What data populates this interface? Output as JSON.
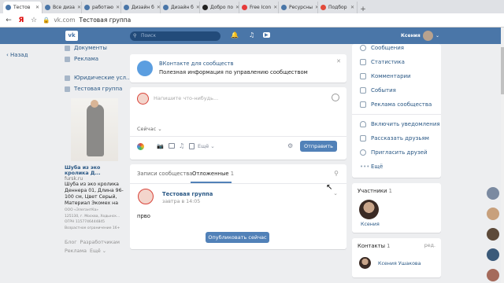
{
  "browser": {
    "tabs": [
      {
        "label": "Тестов",
        "color": "#4a76a8",
        "active": true
      },
      {
        "label": "Все диза",
        "color": "#4a76a8"
      },
      {
        "label": "работаю",
        "color": "#4a76a8"
      },
      {
        "label": "Дизайн б",
        "color": "#4a76a8"
      },
      {
        "label": "Дизайн б",
        "color": "#4a76a8"
      },
      {
        "label": "Добро по",
        "color": "#222222"
      },
      {
        "label": "Free Icon",
        "color": "#e63a3a"
      },
      {
        "label": "Ресурсны",
        "color": "#4a76a8"
      },
      {
        "label": "Подбор",
        "color": "#e24a3a"
      }
    ],
    "url": "vk.com",
    "page_title": "Тестовая группа"
  },
  "vk": {
    "search_placeholder": "Поиск",
    "user_name": "Ксения",
    "left_nav_back": "Назад",
    "left_menu": [
      "Документы",
      "Реклама",
      "Юридические усл...",
      "Тестовая группа"
    ],
    "ad": {
      "title": "Шуба из эко кролика Д...",
      "site": "fursk.ru",
      "desc": [
        "Шуба из эко кролика",
        "Деннера 01, Длина 96-",
        "100 см, Цвет Серый,",
        "Материал Экомех на"
      ],
      "small": [
        "ООО «ЭлегантКа»",
        "125130, г. Москва, Ходынск...",
        "ОГРН 1157746444845",
        "",
        "Возрастное ограничение 16+"
      ]
    },
    "footer": [
      "Блог",
      "Разработчикам",
      "Реклама",
      "Ещё ⌄"
    ]
  },
  "banner": {
    "title": "ВКонтакте для сообществ",
    "subtitle": "Полезная информация по управлению сообществом"
  },
  "composer": {
    "placeholder": "Напишите что-нибудь...",
    "when": "Сейчас ⌄",
    "more": "Ещё ⌄",
    "submit": "Отправить"
  },
  "posts_tabs": {
    "tab1": "Записи сообщества",
    "tab2": "Отложенные",
    "tab2_count": "1"
  },
  "post": {
    "author": "Тестовая группа",
    "time": "завтра в 14:05",
    "text": "прво",
    "publish_btn": "Опубликовать сейчас"
  },
  "right_menu": [
    "Сообщения",
    "Статистика",
    "Комментарии",
    "События",
    "Реклама сообщества",
    "Включить уведомления",
    "Рассказать друзьям",
    "Пригласить друзей",
    "Ещё"
  ],
  "members": {
    "label": "Участники",
    "count": "1",
    "name": "Ксения"
  },
  "contacts": {
    "label": "Контакты",
    "count": "1",
    "edit": "ред.",
    "name": "Ксения Ушакова"
  }
}
